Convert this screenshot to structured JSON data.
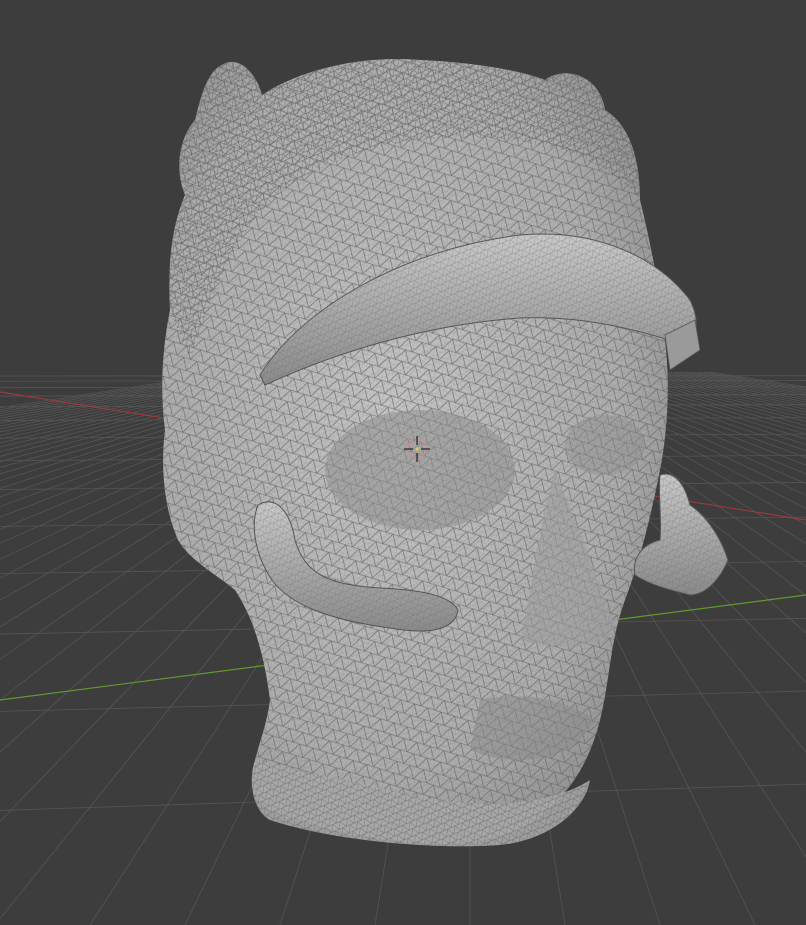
{
  "viewport": {
    "view": "3d-perspective",
    "shading": "solid-wireframe-overlay",
    "object": "head-sculpt-mesh",
    "grid": "on",
    "axis_lines": [
      "x-red",
      "y-green"
    ],
    "colors": {
      "background": "#3d3d3d",
      "grid": "#555555",
      "x_axis": "#9b3a3a",
      "y_axis": "#5e9b2e",
      "mesh_fill": "#b3b3b3",
      "wire": "#5e5e5e",
      "origin_marker": "#e08080"
    }
  }
}
